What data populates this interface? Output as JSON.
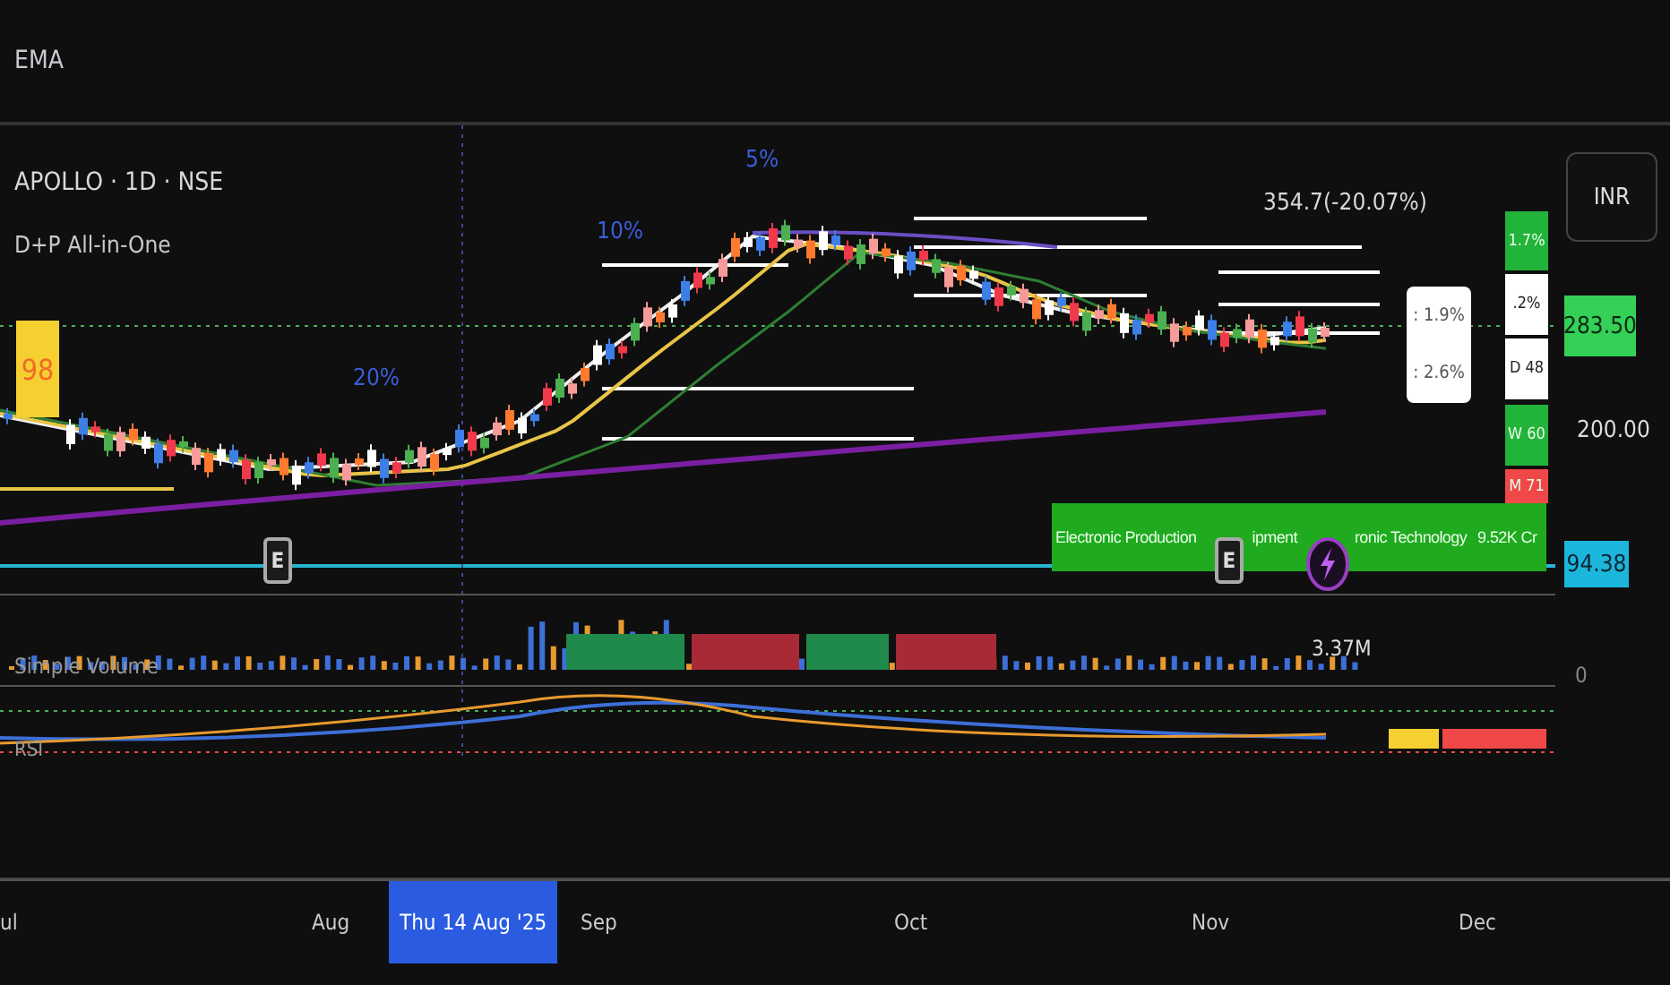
{
  "toolbar": {
    "title": "EMA"
  },
  "chart": {
    "symbol": "APOLLO · 1D · NSE",
    "indicator": "D+P All-in-One",
    "score_badge": "98",
    "move_labels": [
      "20%",
      "10%",
      "5%"
    ],
    "target_label": "354.7(-20.07%)",
    "distance_labels": [
      ": 1.9%",
      ": 2.6%"
    ],
    "strength_boxes": [
      {
        "text": "1.7%",
        "color": "#22b33a"
      },
      {
        "text": ".2%",
        "color": "#ffffff"
      },
      {
        "text": "D 48",
        "color": "#ffffff"
      },
      {
        "text": "W 60",
        "color": "#22b33a"
      },
      {
        "text": "M 71",
        "color": "#f04848"
      }
    ],
    "info_banner": {
      "industry": "Electronic Production",
      "industry_rest": "ipment",
      "sector": "ronic Technology",
      "market_cap": "9.52K Cr"
    },
    "event_markers": [
      "E",
      "E"
    ]
  },
  "price_axis": {
    "currency": "INR",
    "labels": [
      {
        "text": "283.50",
        "kind": "current"
      },
      {
        "text": "200.00",
        "kind": "tick"
      },
      {
        "text": "94.38",
        "kind": "marker"
      }
    ]
  },
  "volume_pane": {
    "title": "Simple Volume",
    "reading": "3.37M",
    "axis_label": "0"
  },
  "rsi_pane": {
    "title": "RSI"
  },
  "time_axis": {
    "labels": [
      {
        "text": "ul",
        "selected": false
      },
      {
        "text": "Aug",
        "selected": false
      },
      {
        "text": "Thu 14 Aug '25",
        "selected": true
      },
      {
        "text": "Sep",
        "selected": false
      },
      {
        "text": "Oct",
        "selected": false
      },
      {
        "text": "Nov",
        "selected": false
      },
      {
        "text": "Dec",
        "selected": false
      }
    ]
  }
}
